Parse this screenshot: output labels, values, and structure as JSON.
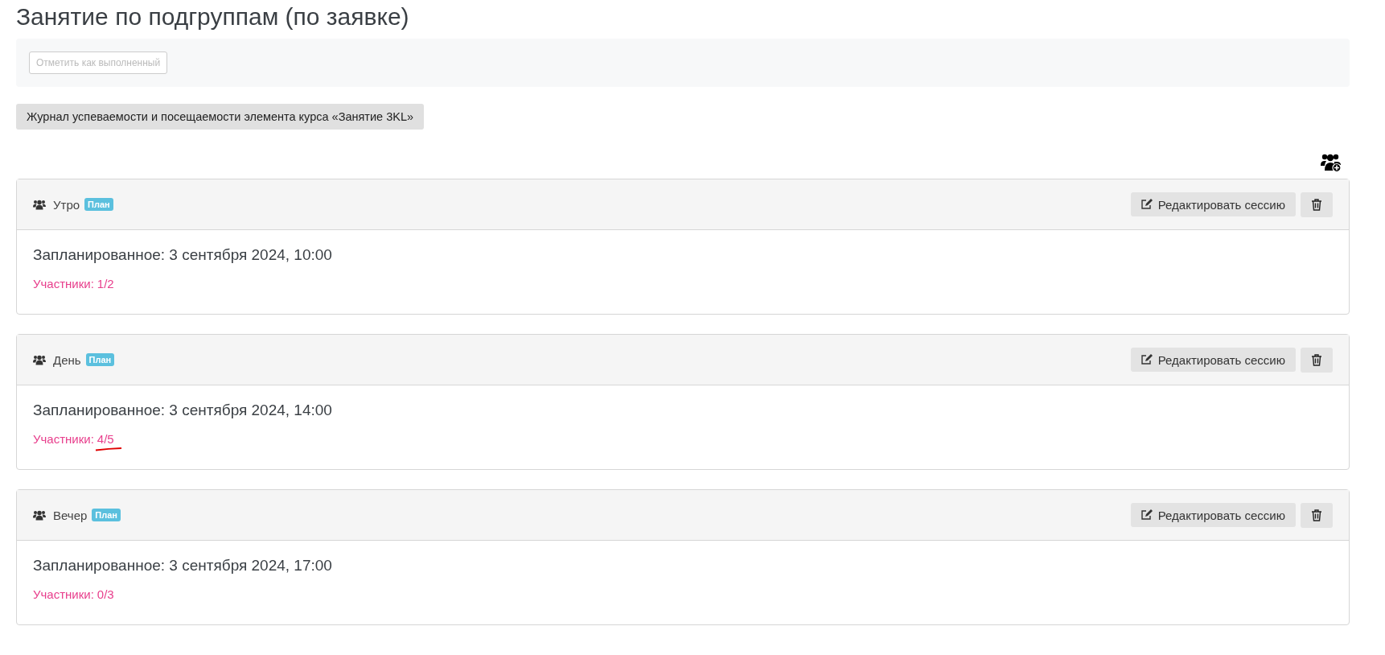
{
  "title": "Занятие по подгруппам (по заявке)",
  "toolbar": {
    "mark_done_button": {
      "label": "Отметить как выполненный",
      "disabled": true
    }
  },
  "journal_button": "Журнал успеваемости и посещаемости элемента курса «Занятие 3KL»",
  "sessions": [
    {
      "name": "Утро",
      "badge": "План",
      "edit_button": "Редактировать сессию",
      "scheduled": "Запланированное: 3 сентября 2024, 10:00",
      "participants_label": "Участники:",
      "participants_count": "1/2",
      "underlined": false
    },
    {
      "name": "День",
      "badge": "План",
      "edit_button": "Редактировать сессию",
      "scheduled": "Запланированное: 3 сентября 2024, 14:00",
      "participants_label": "Участники:",
      "participants_count": "4/5",
      "underlined": true
    },
    {
      "name": "Вечер",
      "badge": "План",
      "edit_button": "Редактировать сессию",
      "scheduled": "Запланированное: 3 сентября 2024, 17:00",
      "participants_label": "Участники:",
      "participants_count": "0/3",
      "underlined": false
    }
  ]
}
